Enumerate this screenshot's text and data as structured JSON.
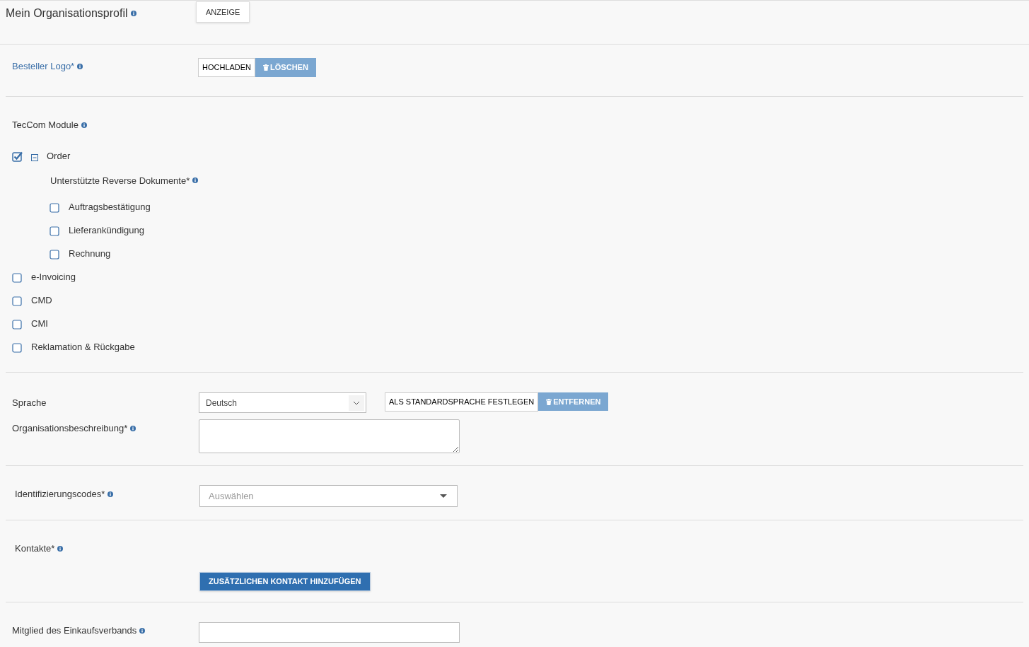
{
  "page": {
    "title": "Mein Organisationsprofil",
    "view_button": "ANZEIGE"
  },
  "logo": {
    "label": "Besteller Logo*",
    "upload_button": "HOCHLADEN",
    "delete_button": "LÖSCHEN"
  },
  "modules": {
    "label": "TecCom Module",
    "items": [
      {
        "label": "Order",
        "checked": true,
        "expanded": true,
        "sub_label": "Unterstützte Reverse Dokumente*",
        "children": [
          {
            "label": "Auftragsbestätigung",
            "checked": false
          },
          {
            "label": "Lieferankündigung",
            "checked": false
          },
          {
            "label": "Rechnung",
            "checked": false
          }
        ]
      },
      {
        "label": "e-Invoicing",
        "checked": false
      },
      {
        "label": "CMD",
        "checked": false
      },
      {
        "label": "CMI",
        "checked": false
      },
      {
        "label": "Reklamation & Rückgabe",
        "checked": false
      }
    ]
  },
  "language": {
    "label": "Sprache",
    "value": "Deutsch",
    "default_button": "ALS STANDARDSPRACHE FESTLEGEN",
    "remove_button": "ENTFERNEN"
  },
  "description": {
    "label": "Organisationsbeschreibung*"
  },
  "identification": {
    "label": "Identifizierungscodes*",
    "placeholder": "Auswählen"
  },
  "contacts": {
    "label": "Kontakte*",
    "add_button": "ZUSÄTZLICHEN KONTAKT HINZUFÜGEN"
  },
  "membership": {
    "label": "Mitglied des Einkaufsverbands"
  }
}
